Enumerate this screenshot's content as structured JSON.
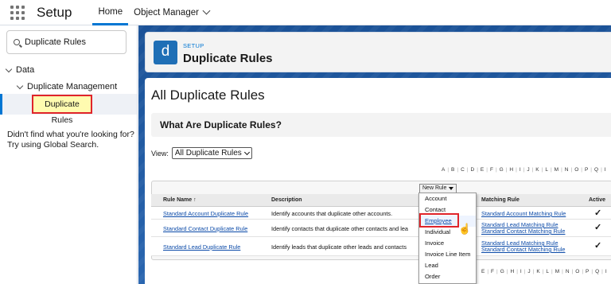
{
  "topbar": {
    "app_name": "Setup",
    "tabs": [
      {
        "label": "Home"
      },
      {
        "label": "Object Manager"
      }
    ]
  },
  "sidebar": {
    "search_value": "Duplicate Rules",
    "tree": [
      {
        "label": "Data"
      },
      {
        "label": "Duplicate Management"
      },
      {
        "label": "Duplicate Rules"
      }
    ],
    "help_line1": "Didn't find what you're looking for?",
    "help_line2": "Try using Global Search."
  },
  "header": {
    "icon_letter": "d",
    "setup_label": "SETUP",
    "title": "Duplicate Rules"
  },
  "content": {
    "heading": "All Duplicate Rules",
    "what_title": "What Are Duplicate Rules?",
    "view_label": "View:",
    "view_value": "All Duplicate Rules",
    "alphabet": [
      "A",
      "B",
      "C",
      "D",
      "E",
      "F",
      "G",
      "H",
      "I",
      "J",
      "K",
      "L",
      "M",
      "N",
      "O",
      "P",
      "Q",
      "I"
    ],
    "alphabet_bottom": [
      "E",
      "F",
      "G",
      "H",
      "I",
      "J",
      "K",
      "L",
      "M",
      "N",
      "O",
      "P",
      "Q",
      "I"
    ],
    "new_rule_label": "New Rule",
    "columns": [
      "Rule Name ↑",
      "Description",
      "Matching Rule",
      "Active"
    ],
    "rows": [
      {
        "name": "Standard Account Duplicate Rule",
        "description": "Identify accounts that duplicate other accounts.",
        "matching": [
          "Standard Account Matching Rule"
        ],
        "active": "✓"
      },
      {
        "name": "Standard Contact Duplicate Rule",
        "description": "Identify contacts that duplicate other contacts and lea",
        "matching": [
          "Standard Lead Matching Rule",
          "Standard Contact Matching Rule"
        ],
        "active": "✓"
      },
      {
        "name": "Standard Lead Duplicate Rule",
        "description": "Identify leads that duplicate other leads and contacts",
        "matching": [
          "Standard Lead Matching Rule",
          "Standard Contact Matching Rule"
        ],
        "active": "✓"
      }
    ]
  },
  "dropdown": {
    "items": [
      "Account",
      "Contact",
      "Employee",
      "Individual",
      "Invoice",
      "Invoice Line Item",
      "Lead",
      "Order"
    ]
  },
  "colors": {
    "accent": "#0176d3",
    "highlight_border": "#e0242a",
    "banner_bg": "#1b5297"
  }
}
